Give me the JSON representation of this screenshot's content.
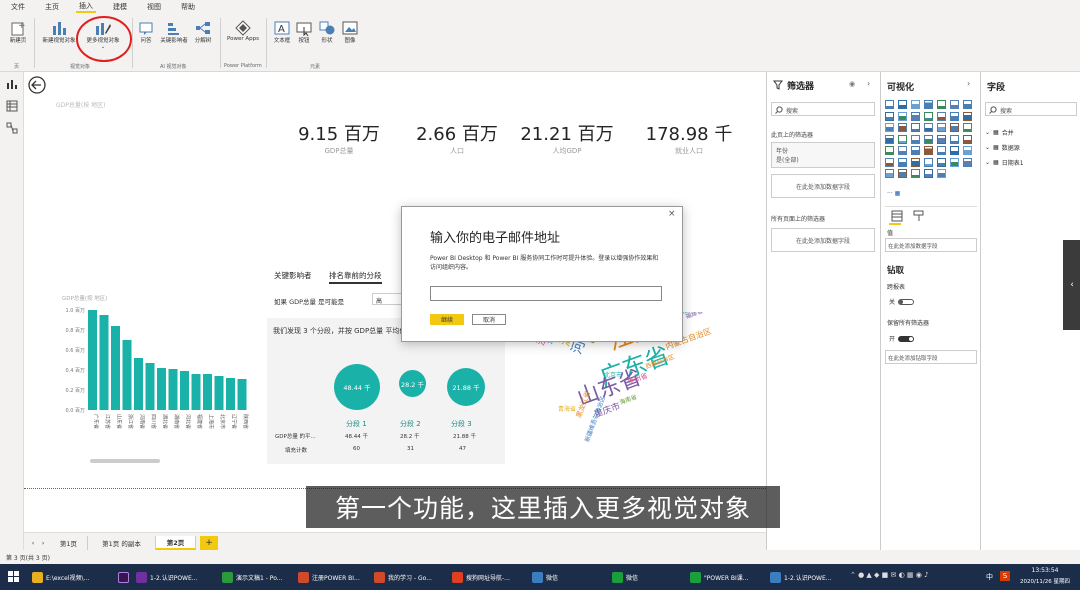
{
  "menu": [
    "文件",
    "主页",
    "插入",
    "建模",
    "视图",
    "帮助"
  ],
  "menu_active": "插入",
  "ribbon": {
    "buttons": [
      {
        "label": "新建页",
        "icon": "new-page-icon"
      },
      {
        "label": "新建视觉对象",
        "icon": "new-visual-icon"
      },
      {
        "label": "更多视觉对象",
        "icon": "more-visuals-icon"
      },
      {
        "label": "问答",
        "icon": "qa-icon"
      },
      {
        "label": "关键影响者",
        "icon": "key-influencers-icon"
      },
      {
        "label": "分解树",
        "icon": "decomposition-tree-icon"
      },
      {
        "label": "Power Apps",
        "icon": "power-apps-icon"
      },
      {
        "label": "文本框",
        "icon": "textbox-icon"
      },
      {
        "label": "按钮",
        "icon": "buttons-icon"
      },
      {
        "label": "形状",
        "icon": "shapes-icon"
      },
      {
        "label": "图像",
        "icon": "image-icon"
      }
    ],
    "groups": [
      "页",
      "视觉对象",
      "AI 视觉对象",
      "Power Platform",
      "元素"
    ]
  },
  "canvas": {
    "chart_subtitle": "GDP总量(按 地区)",
    "kpis": [
      {
        "value": "9.15 百万",
        "label": "GDP总量"
      },
      {
        "value": "2.66 百万",
        "label": "人口"
      },
      {
        "value": "21.21 百万",
        "label": "人均GDP"
      },
      {
        "value": "178.98 千",
        "label": "就业人口"
      }
    ],
    "influencer_tabs": [
      "关键影响者",
      "排名靠前的分段"
    ],
    "condition_text": "如果 GDP总量 是可能是",
    "condition_value": "高",
    "found_text": "我们发现 3 个分段，并按 GDP总量 平均值排序",
    "segments": [
      {
        "circle": "48.44 千",
        "name": "分段 1",
        "avg": "48.44 千",
        "count": "60"
      },
      {
        "circle": "28.2 千",
        "name": "分段 2",
        "avg": "28.2 千",
        "count": "31"
      },
      {
        "circle": "21.88 千",
        "name": "分段 3",
        "avg": "21.88 千",
        "count": "47"
      }
    ],
    "seg_row_labels": [
      "GDP总量 的平...",
      "填充计数"
    ]
  },
  "chart_data": {
    "type": "bar",
    "title": "GDP总量(按 地区)",
    "categories": [
      "广东省",
      "江苏省",
      "山东省",
      "浙江省",
      "河南省",
      "四川省",
      "湖北省",
      "湖南省",
      "河北省",
      "福建省",
      "上海市",
      "北京市",
      "辽宁省",
      "陕西省"
    ],
    "values": [
      1.0,
      0.95,
      0.84,
      0.7,
      0.52,
      0.47,
      0.42,
      0.41,
      0.39,
      0.36,
      0.36,
      0.34,
      0.32,
      0.31
    ],
    "ylim": [
      0,
      1.0
    ],
    "ytick_labels": [
      "1.0 百万",
      "0.8 百万",
      "0.6 百万",
      "0.4 百万",
      "0.2 百万",
      "0.0 百万"
    ]
  },
  "wordcloud": [
    "江苏省",
    "广东省",
    "山东省",
    "河南省",
    "浙江省",
    "湖北省",
    "四川省",
    "内蒙古自治区",
    "广西壮族自治区",
    "重庆市",
    "江西省",
    "贵州省",
    "云南省",
    "山西省",
    "黑龙江省",
    "天津市",
    "吉林省",
    "新疆维吾尔自治区",
    "宁夏回族自治区",
    "青海省",
    "海南省",
    "西藏自治区",
    "北京市",
    "福建省"
  ],
  "wordcloud_colors": [
    "#e8891b",
    "#1ab2a8",
    "#7a5aa6",
    "#3a7ebf",
    "#d44c8a",
    "#e0b020",
    "#6a9b3a"
  ],
  "dialog": {
    "title": "输入你的电子邮件地址",
    "body": "Power BI Desktop 和 Power BI 服务协同工作时可提升体验。登录以增强协作效果和访问组织内容。",
    "input_value": "",
    "primary": "继续",
    "secondary": "取消"
  },
  "filters": {
    "title": "筛选器",
    "search_placeholder": "搜索",
    "page_filters_label": "此页上的筛选器",
    "field_name": "年份",
    "field_value": "是(全部)",
    "add_here": "在此处添加数据字段",
    "all_pages_label": "所有页面上的筛选器",
    "add_here2": "在此处添加数据字段"
  },
  "viz": {
    "title": "可视化",
    "values_label": "值",
    "values_placeholder": "在此处添加数据字段",
    "drill_title": "钻取",
    "cross_report": "跨报表",
    "off": "关",
    "keep_filters": "保留所有筛选器",
    "on": "开",
    "drill_placeholder": "在此处添加钻取字段"
  },
  "fields": {
    "title": "字段",
    "search_placeholder": "搜索",
    "tables": [
      "合并",
      "数据源",
      "日期表1"
    ]
  },
  "pagetabs": [
    "第1页",
    "第1页 的副本",
    "第2页"
  ],
  "pagetab_active": "第2页",
  "status": "第 3 页(共 3 页)",
  "subtitle": "第一个功能，这里插入更多视觉对象",
  "taskbar": {
    "items": [
      "E:\\excel视频\\...",
      "1-2.认识POWE...",
      "演示文稿1 - Po...",
      "注册POWER BI...",
      "我的学习 - Go...",
      "搜狗网址导航-...",
      "微信",
      "微信",
      "\"POWER BI课...",
      "1-2.认识POWE..."
    ],
    "time": "13:53:54",
    "date": "2020/11/26 星期四",
    "lang": "中"
  },
  "accent": "#1ab2a8",
  "highlight": "#f2c811"
}
